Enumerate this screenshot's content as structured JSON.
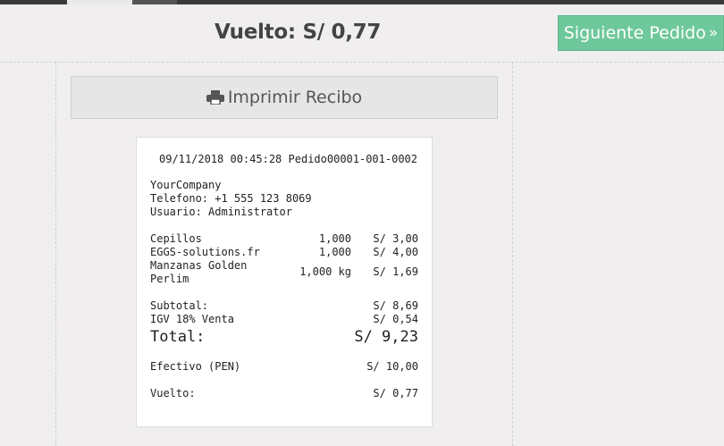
{
  "header": {
    "change_label": "Vuelto: S/ 0,77",
    "next_order_label": "Siguiente Pedido",
    "next_icon": "double-chevron-right-icon"
  },
  "actions": {
    "print_label": "Imprimir Recibo",
    "print_icon": "printer-icon"
  },
  "receipt": {
    "timestamp": "09/11/2018 00:45:28",
    "order_ref": "Pedido00001-001-0002",
    "company": "YourCompany",
    "phone": "Telefono: +1 555 123 8069",
    "user": "Usuario: Administrator",
    "lines": [
      {
        "name": "Cepillos",
        "qty": "1,000",
        "price": "S/ 3,00"
      },
      {
        "name": "EGGS-solutions.fr",
        "qty": "1,000",
        "price": "S/ 4,00"
      },
      {
        "name": "Manzanas Golden",
        "name2": "Perlim",
        "qty": "1,000 kg",
        "price": "S/ 1,69"
      }
    ],
    "subtotal_label": "Subtotal:",
    "subtotal_value": "S/ 8,69",
    "tax_label": "IGV 18% Venta",
    "tax_value": "S/ 0,54",
    "total_label": "Total:",
    "total_value": "S/ 9,23",
    "payment_label": "Efectivo (PEN)",
    "payment_value": "S/ 10,00",
    "change_label": "Vuelto:",
    "change_value": "S/ 0,77"
  },
  "colors": {
    "accent": "#6ec89b",
    "background": "#f0eeee",
    "topbar": "#3a3a3a"
  }
}
